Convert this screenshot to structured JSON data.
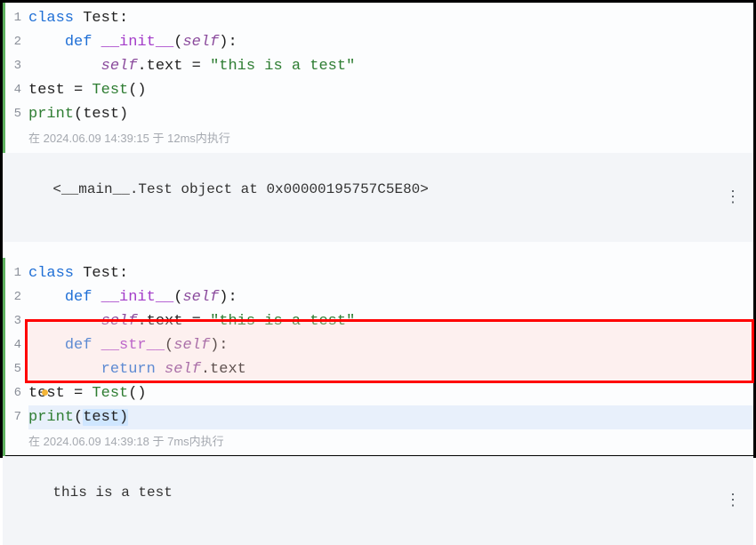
{
  "block1": {
    "lines": [
      {
        "n": "1",
        "segs": [
          {
            "t": "class ",
            "c": "tk-kw"
          },
          {
            "t": "Test:",
            "c": "tk-plain"
          }
        ]
      },
      {
        "n": "2",
        "segs": [
          {
            "t": "    ",
            "c": ""
          },
          {
            "t": "def ",
            "c": "tk-kw"
          },
          {
            "t": "__init__",
            "c": "tk-def"
          },
          {
            "t": "(",
            "c": "tk-plain"
          },
          {
            "t": "self",
            "c": "tk-self"
          },
          {
            "t": "):",
            "c": "tk-plain"
          }
        ]
      },
      {
        "n": "3",
        "segs": [
          {
            "t": "        ",
            "c": ""
          },
          {
            "t": "self",
            "c": "tk-self"
          },
          {
            "t": ".text = ",
            "c": "tk-plain"
          },
          {
            "t": "\"this is a test\"",
            "c": "tk-str"
          }
        ]
      },
      {
        "n": "4",
        "segs": [
          {
            "t": "test = ",
            "c": "tk-plain"
          },
          {
            "t": "Test",
            "c": "tk-call"
          },
          {
            "t": "()",
            "c": "tk-plain"
          }
        ]
      },
      {
        "n": "5",
        "segs": [
          {
            "t": "print",
            "c": "tk-builtin"
          },
          {
            "t": "(test)",
            "c": "tk-plain"
          }
        ]
      }
    ],
    "timestamp": "在 2024.06.09 14:39:15 于 12ms内执行",
    "output": "<__main__.Test object at 0x00000195757C5E80>"
  },
  "block2": {
    "lines": [
      {
        "n": "1",
        "segs": [
          {
            "t": "class ",
            "c": "tk-kw"
          },
          {
            "t": "Test:",
            "c": "tk-plain"
          }
        ]
      },
      {
        "n": "2",
        "segs": [
          {
            "t": "    ",
            "c": ""
          },
          {
            "t": "def ",
            "c": "tk-kw"
          },
          {
            "t": "__init__",
            "c": "tk-def"
          },
          {
            "t": "(",
            "c": "tk-plain"
          },
          {
            "t": "self",
            "c": "tk-self"
          },
          {
            "t": "):",
            "c": "tk-plain"
          }
        ]
      },
      {
        "n": "3",
        "segs": [
          {
            "t": "        ",
            "c": ""
          },
          {
            "t": "self",
            "c": "tk-self"
          },
          {
            "t": ".text = ",
            "c": "tk-plain"
          },
          {
            "t": "\"this is a test\"",
            "c": "tk-str"
          }
        ]
      },
      {
        "n": "4",
        "segs": [
          {
            "t": "    ",
            "c": ""
          },
          {
            "t": "def ",
            "c": "tk-kw"
          },
          {
            "t": "__str__",
            "c": "tk-def"
          },
          {
            "t": "(",
            "c": "tk-plain"
          },
          {
            "t": "self",
            "c": "tk-self"
          },
          {
            "t": "):",
            "c": "tk-plain"
          }
        ]
      },
      {
        "n": "5",
        "segs": [
          {
            "t": "        ",
            "c": ""
          },
          {
            "t": "return ",
            "c": "tk-kw"
          },
          {
            "t": "self",
            "c": "tk-self"
          },
          {
            "t": ".text",
            "c": "tk-plain"
          }
        ]
      },
      {
        "n": "6",
        "segs": [
          {
            "t": "test = ",
            "c": "tk-plain"
          },
          {
            "t": "Test",
            "c": "tk-call"
          },
          {
            "t": "()",
            "c": "tk-plain"
          }
        ]
      },
      {
        "n": "7",
        "segs": [
          {
            "t": "print",
            "c": "tk-builtin"
          },
          {
            "t": "(",
            "c": "tk-plain"
          },
          {
            "t": "test",
            "c": "tk-plain",
            "hl": true
          },
          {
            "t": ")",
            "c": "tk-plain",
            "hl": true
          }
        ]
      }
    ],
    "timestamp": "在 2024.06.09 14:39:18 于 7ms内执行",
    "output": "this is a test"
  },
  "menu_glyph": "⋮"
}
